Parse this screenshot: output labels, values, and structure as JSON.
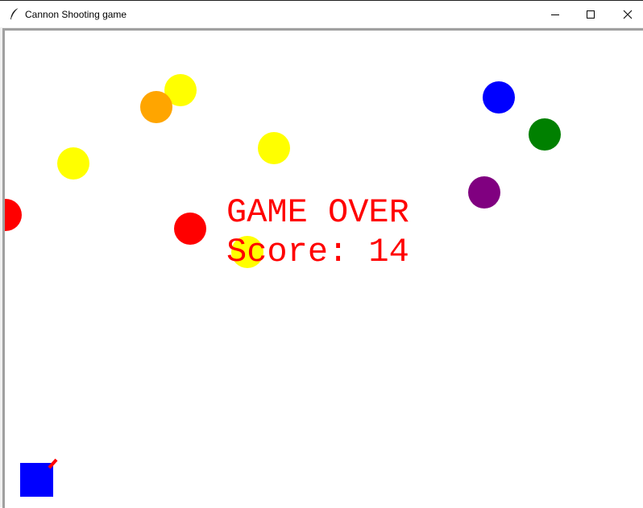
{
  "window": {
    "title": "Cannon Shooting game",
    "icon": "feather-icon",
    "controls": {
      "minimize_icon": "minimize-icon",
      "maximize_icon": "maximize-icon",
      "close_icon": "close-icon"
    }
  },
  "game": {
    "background": "#ffffff",
    "message": {
      "line1": "GAME OVER",
      "line2": "Score: 14",
      "color": "#ff0000"
    },
    "balls": [
      {
        "name": "ball-yellow",
        "color": "#ffff00"
      },
      {
        "name": "ball-orange",
        "color": "#ffa500"
      },
      {
        "name": "ball-yellow",
        "color": "#ffff00"
      },
      {
        "name": "ball-yellow",
        "color": "#ffff00"
      },
      {
        "name": "ball-red",
        "color": "#ff0000"
      },
      {
        "name": "ball-red",
        "color": "#ff0000"
      },
      {
        "name": "ball-yellow",
        "color": "#ffff00"
      },
      {
        "name": "ball-blue",
        "color": "#0000ff"
      },
      {
        "name": "ball-green",
        "color": "#008000"
      },
      {
        "name": "ball-purple",
        "color": "#800080"
      }
    ],
    "cannon": {
      "body_color": "#0000ff",
      "barrel_color": "#ff0000"
    }
  }
}
